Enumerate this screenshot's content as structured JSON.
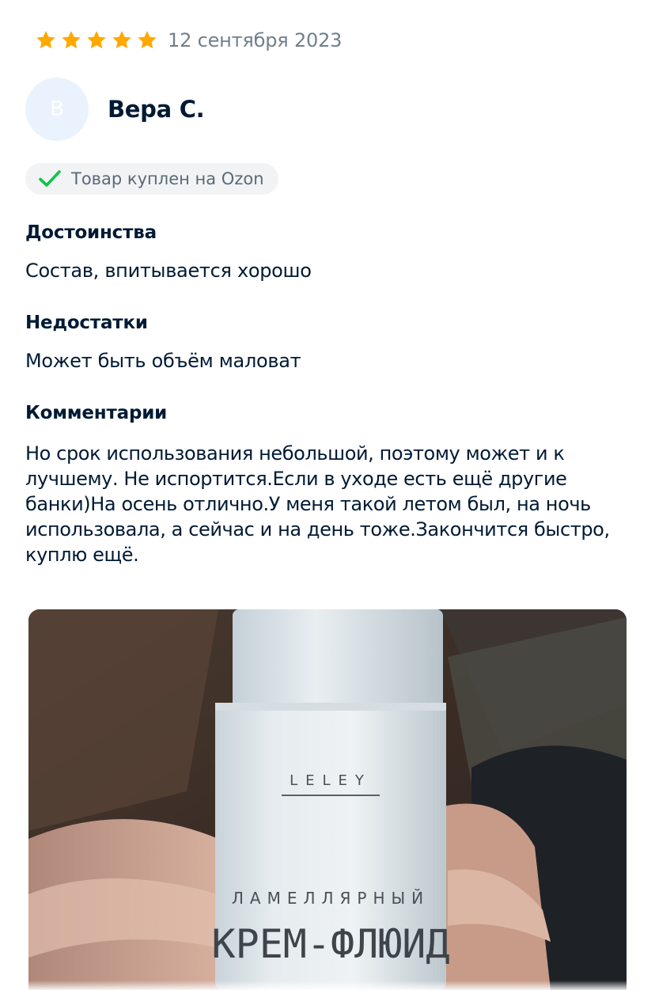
{
  "review": {
    "rating": 5,
    "star_color": "#ffa800",
    "date": "12 сентября 2023",
    "author": {
      "name": "Вера С.",
      "avatar_letter": "В",
      "avatar_bg": "#eaf3fd"
    },
    "purchase_badge": {
      "icon": "check-icon",
      "icon_color": "#10c44c",
      "text": "Товар куплен на Ozon"
    },
    "pros": {
      "title": "Достоинства",
      "text": "Состав, впитывается хорошо"
    },
    "cons": {
      "title": "Недостатки",
      "text": "Может быть объём маловат"
    },
    "comment": {
      "title": "Комментарии",
      "text": "Но срок использования небольшой, поэтому может и к лучшему. Не испортится.Если в уходе есть ещё другие банки)На осень отлично.У меня такой летом был, на ночь использовала, а сейчас и на день тоже.Закончится быстро, куплю ещё."
    },
    "photo": {
      "brand": "LELEY",
      "label_line1": "ЛАМЕЛЛЯРНЫЙ",
      "label_line2": "КРЕМ-ФЛЮИД"
    }
  }
}
